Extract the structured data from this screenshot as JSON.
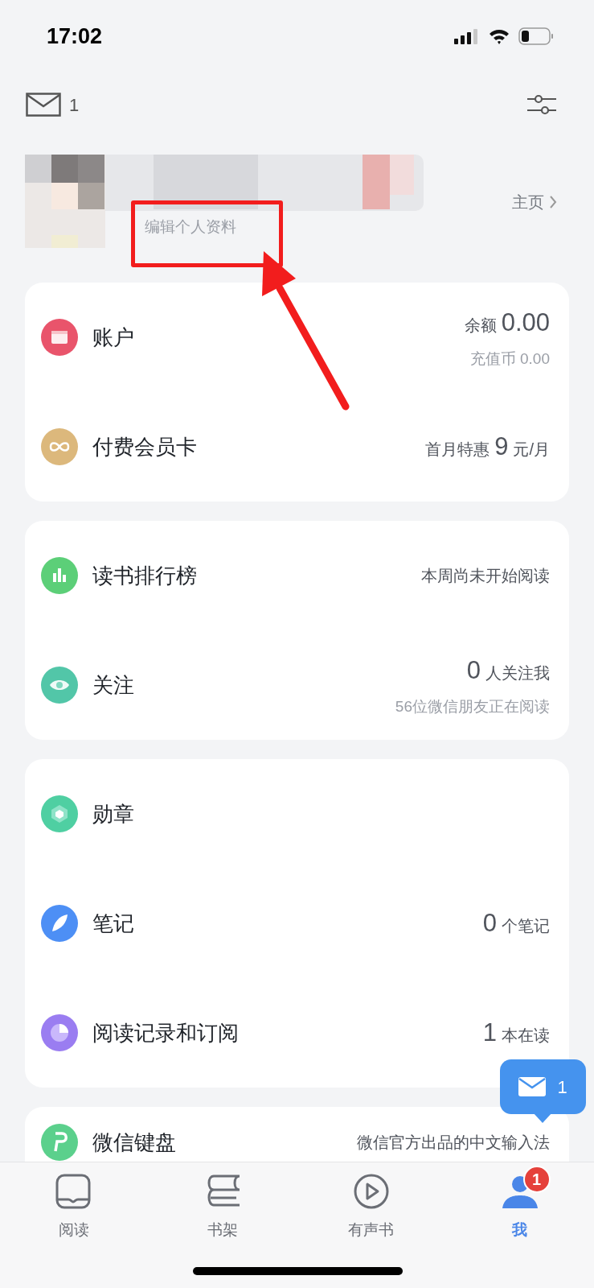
{
  "status_bar": {
    "time": "17:02"
  },
  "header": {
    "mail_count": "1"
  },
  "profile": {
    "edit_link": "编辑个人资料",
    "homepage_link": "主页"
  },
  "cards": [
    {
      "rows": [
        {
          "color": "#e9546b",
          "title": "账户",
          "line": [
            {
              "text": "余额",
              "big": false
            },
            {
              "text": "0.00",
              "big": true
            }
          ],
          "sub": "充值币 0.00"
        },
        {
          "color": "#dcb87c",
          "title": "付费会员卡",
          "line": [
            {
              "text": "首月特惠",
              "big": false
            },
            {
              "text": "9",
              "big": true
            },
            {
              "text": "元/月",
              "big": false
            }
          ]
        }
      ]
    },
    {
      "rows": [
        {
          "color": "#5ccf78",
          "title": "读书排行榜",
          "line": [
            {
              "text": "本周尚未开始阅读",
              "big": false
            }
          ]
        },
        {
          "color": "#52c6a8",
          "title": "关注",
          "line": [
            {
              "text": "0",
              "big": true
            },
            {
              "text": "人关注我",
              "big": false
            }
          ],
          "sub": "56位微信朋友正在阅读"
        }
      ]
    },
    {
      "rows": [
        {
          "color": "#4fcfa2",
          "title": "勋章"
        },
        {
          "color": "#4d8ff5",
          "title": "笔记",
          "line": [
            {
              "text": "0",
              "big": true
            },
            {
              "text": "个笔记",
              "big": false
            }
          ]
        },
        {
          "color": "#9a7df1",
          "title": "阅读记录和订阅",
          "line": [
            {
              "text": "1",
              "big": true
            },
            {
              "text": "本在读",
              "big": false
            }
          ]
        }
      ]
    },
    {
      "rows": [
        {
          "color": "#5bd08c",
          "title": "微信键盘",
          "line": [
            {
              "text": "微信官方出品的中文输入法",
              "big": false
            }
          ]
        }
      ]
    }
  ],
  "message_bubble": {
    "count": "1"
  },
  "tabs": [
    {
      "label": "阅读",
      "selected": false
    },
    {
      "label": "书架",
      "selected": false
    },
    {
      "label": "有声书",
      "selected": false
    },
    {
      "label": "我",
      "selected": true,
      "badge": "1"
    }
  ]
}
